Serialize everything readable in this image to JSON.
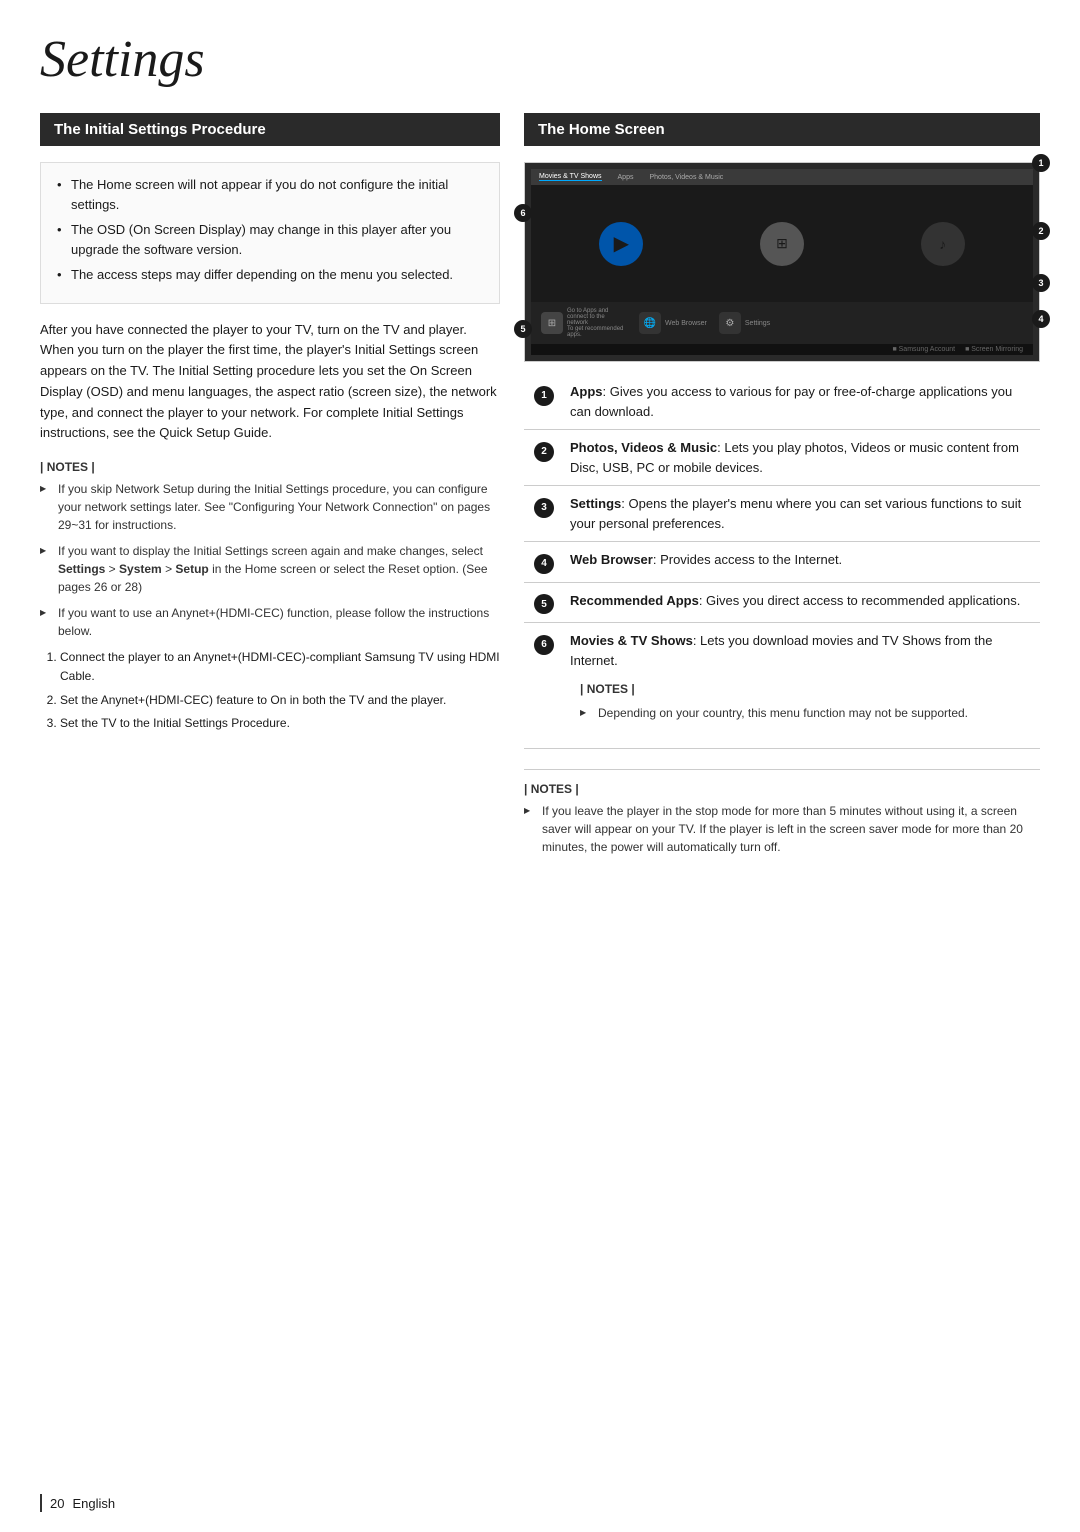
{
  "page": {
    "title": "Settings",
    "footer_page": "20",
    "footer_lang": "English"
  },
  "left_section": {
    "header": "The Initial Settings Procedure",
    "bullets": [
      "The Home screen will not appear if you do not configure the initial settings.",
      "The OSD (On Screen Display) may change in this player after you upgrade the software version.",
      "The access steps may differ depending on the menu you selected."
    ],
    "body": "After you have connected the player to your TV, turn on the TV and player. When you turn on the player the first time, the player's Initial Settings screen appears on the TV. The Initial Setting procedure lets you set the On Screen Display (OSD) and menu languages, the aspect ratio (screen size), the network type, and connect the player to your network. For complete Initial Settings instructions, see the Quick Setup Guide.",
    "notes_label": "| NOTES |",
    "notes": [
      "If you skip Network Setup during the Initial Settings procedure, you can configure your network settings later. See \"Configuring Your Network Connection\" on pages 29~31 for instructions.",
      "If you want to display the Initial Settings screen again and make changes, select Settings > System > Setup in the Home screen or select the Reset option. (See pages 26 or 28)",
      "If you want to use an Anynet+(HDMI-CEC) function, please follow the instructions below."
    ],
    "sub_steps": [
      "Connect the player to an Anynet+(HDMI-CEC)-compliant Samsung TV using HDMI Cable.",
      "Set the Anynet+(HDMI-CEC) feature to On in both the TV and the player.",
      "Set the TV to the Initial Settings Procedure."
    ]
  },
  "right_section": {
    "header": "The Home Screen",
    "nav_items": [
      "Movies & TV Shows",
      "Apps",
      "Photos, Videos & Music"
    ],
    "features": [
      {
        "num": "1",
        "bold": "Apps",
        "text": ": Gives you access to various for pay or free-of-charge applications you can download."
      },
      {
        "num": "2",
        "bold": "Photos, Videos & Music",
        "text": ": Lets you play photos, Videos or music content from Disc, USB, PC or mobile devices."
      },
      {
        "num": "3",
        "bold": "Settings",
        "text": ": Opens the player's menu where you can set various functions to suit your personal preferences."
      },
      {
        "num": "4",
        "bold": "Web Browser",
        "text": ": Provides access to the Internet."
      },
      {
        "num": "5",
        "bold": "Recommended Apps",
        "text": ": Gives you direct access to recommended applications."
      },
      {
        "num": "6",
        "bold": "Movies & TV Shows",
        "text": ": Lets you download movies and TV Shows from the Internet."
      }
    ],
    "num6_notes_label": "| NOTES |",
    "num6_notes": [
      "Depending on your country, this menu function may not be supported."
    ],
    "bottom_notes_label": "| NOTES |",
    "bottom_notes": [
      "If you leave the player in the stop mode for more than 5 minutes without using it, a screen saver will appear on your TV. If the player is left in the screen saver mode for more than 20 minutes, the power will automatically turn off."
    ]
  }
}
